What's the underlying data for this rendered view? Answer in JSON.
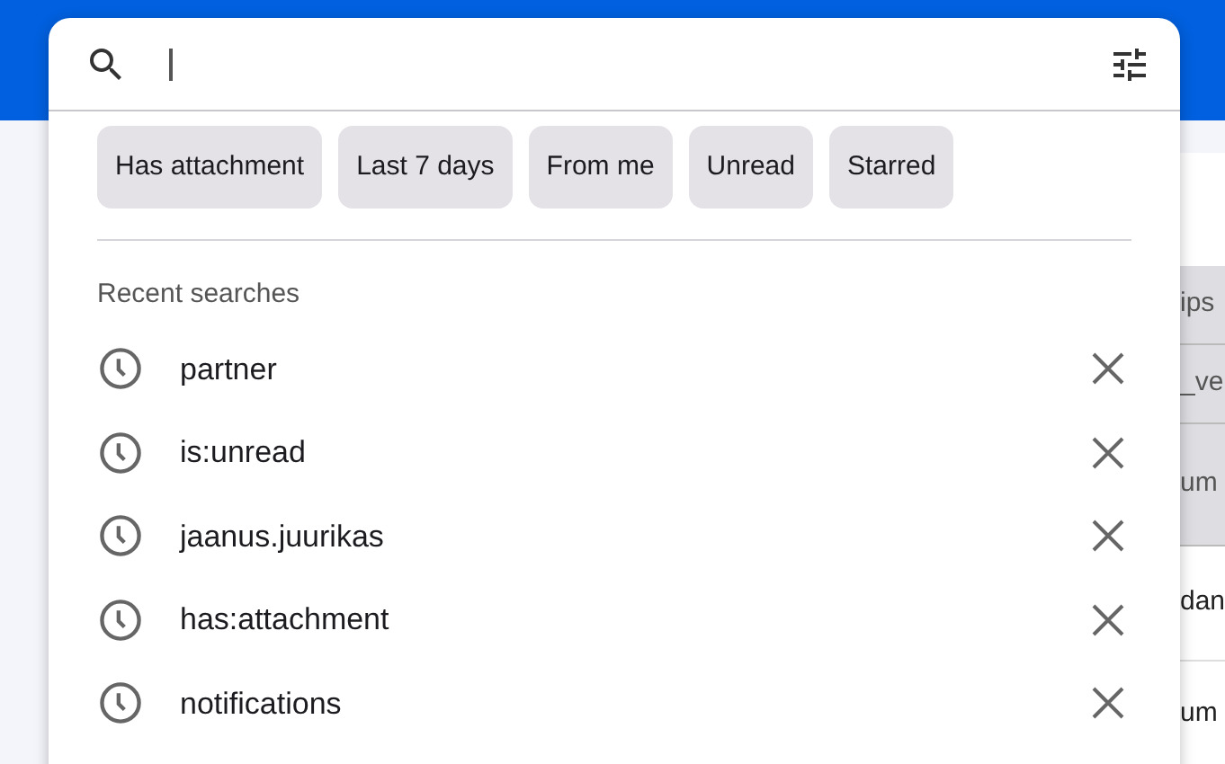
{
  "filter_chips": [
    "Has attachment",
    "Last 7 days",
    "From me",
    "Unread",
    "Starred"
  ],
  "recent_heading": "Recent searches",
  "recent_searches": [
    "partner",
    "is:unread",
    "jaanus.juurikas",
    "has:attachment",
    "notifications"
  ],
  "background_table_rows": [
    {
      "text": "ips",
      "kind": "header"
    },
    {
      "text": "_ve",
      "kind": "header"
    },
    {
      "text": "um",
      "kind": "header"
    },
    {
      "text": "dan",
      "kind": "plain"
    },
    {
      "text": "um",
      "kind": "plain"
    }
  ]
}
